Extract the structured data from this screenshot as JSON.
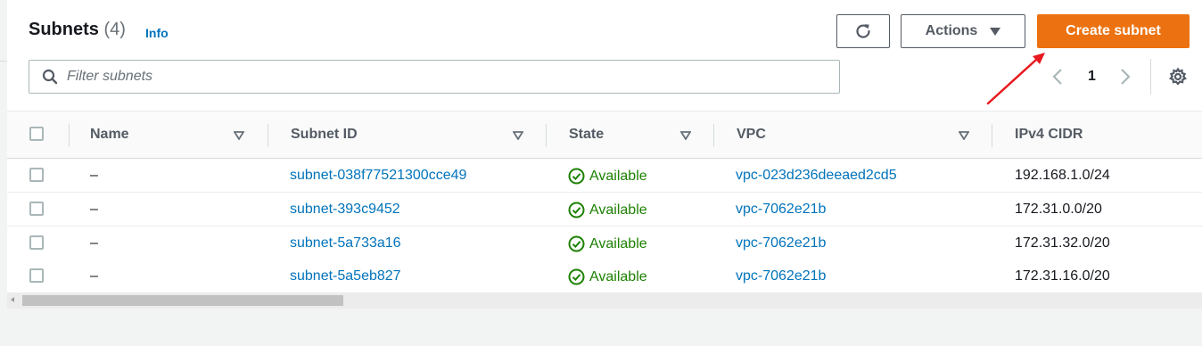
{
  "header": {
    "title": "Subnets",
    "count": "(4)",
    "info_label": "Info"
  },
  "toolbar": {
    "refresh_icon": "refresh-icon",
    "actions_label": "Actions",
    "create_label": "Create subnet",
    "create_color": "#ec7211"
  },
  "search": {
    "placeholder": "Filter subnets",
    "value": ""
  },
  "pagination": {
    "current_page": "1"
  },
  "table": {
    "columns": [
      "Name",
      "Subnet ID",
      "State",
      "VPC",
      "IPv4 CIDR"
    ],
    "rows": [
      {
        "name": "–",
        "subnet_id": "subnet-038f77521300cce49",
        "state": "Available",
        "vpc": "vpc-023d236deeaed2cd5",
        "cidr": "192.168.1.0/24"
      },
      {
        "name": "–",
        "subnet_id": "subnet-393c9452",
        "state": "Available",
        "vpc": "vpc-7062e21b",
        "cidr": "172.31.0.0/20"
      },
      {
        "name": "–",
        "subnet_id": "subnet-5a733a16",
        "state": "Available",
        "vpc": "vpc-7062e21b",
        "cidr": "172.31.32.0/20"
      },
      {
        "name": "–",
        "subnet_id": "subnet-5a5eb827",
        "state": "Available",
        "vpc": "vpc-7062e21b",
        "cidr": "172.31.16.0/20"
      }
    ]
  },
  "colors": {
    "link": "#0073bb",
    "available": "#1d8102",
    "annotation_arrow": "#e8191f"
  }
}
